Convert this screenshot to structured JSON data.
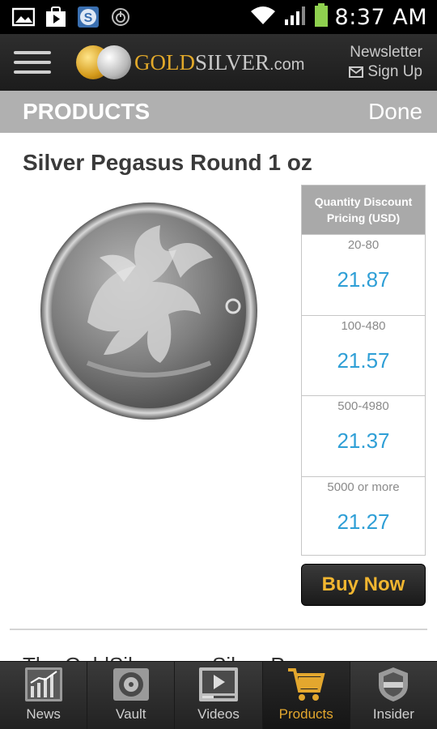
{
  "status_bar": {
    "time": "8:37 AM",
    "icons": [
      "image-icon",
      "play-store-icon",
      "shield-s-icon",
      "power-icon",
      "wifi-icon",
      "signal-icon",
      "battery-icon"
    ]
  },
  "header": {
    "logo_gold": "GOLD",
    "logo_silver": "SILVER",
    "logo_com": ".com",
    "newsletter_line1": "Newsletter",
    "newsletter_line2": "Sign Up"
  },
  "products_bar": {
    "title": "PRODUCTS",
    "done_label": "Done"
  },
  "product": {
    "name": "Silver Pegasus Round 1 oz",
    "pricing_header": "Quantity Discount Pricing (USD)",
    "tiers": [
      {
        "range": "20-80",
        "price": "21.87"
      },
      {
        "range": "100-480",
        "price": "21.57"
      },
      {
        "range": "500-4980",
        "price": "21.37"
      },
      {
        "range": "5000 or more",
        "price": "21.27"
      }
    ],
    "buy_label": "Buy Now",
    "description_partial": "The GoldSilver.com Silver Pegasus"
  },
  "tabs": [
    {
      "label": "News",
      "icon": "chart-icon",
      "active": false
    },
    {
      "label": "Vault",
      "icon": "vault-icon",
      "active": false
    },
    {
      "label": "Videos",
      "icon": "video-icon",
      "active": false
    },
    {
      "label": "Products",
      "icon": "cart-icon",
      "active": true
    },
    {
      "label": "Insider",
      "icon": "insider-badge-icon",
      "active": false
    }
  ],
  "colors": {
    "accent_gold": "#e3a72e",
    "price_blue": "#2f9fd6",
    "products_bar": "#b0b0b0"
  }
}
